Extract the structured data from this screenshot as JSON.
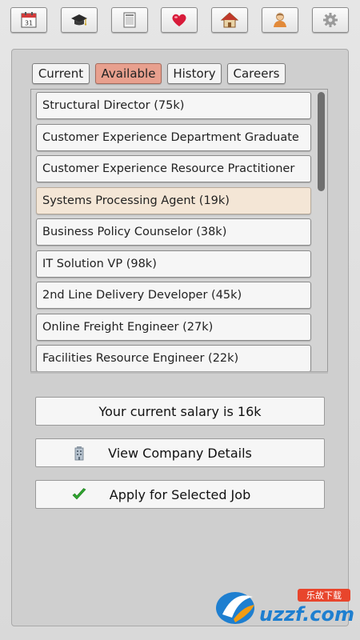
{
  "toolbar": {
    "buttons": [
      {
        "name": "calendar-icon"
      },
      {
        "name": "graduation-cap-icon"
      },
      {
        "name": "newspaper-icon"
      },
      {
        "name": "heart-icon"
      },
      {
        "name": "house-icon"
      },
      {
        "name": "person-icon"
      },
      {
        "name": "gear-icon"
      }
    ],
    "calendar_day": "31"
  },
  "tabs": [
    {
      "label": "Current",
      "active": false
    },
    {
      "label": "Available",
      "active": true
    },
    {
      "label": "History",
      "active": false
    },
    {
      "label": "Careers",
      "active": false
    }
  ],
  "jobs": [
    {
      "label": "Structural Director (75k)",
      "selected": false
    },
    {
      "label": "Customer Experience Department Graduate",
      "selected": false
    },
    {
      "label": "Customer Experience Resource Practitioner",
      "selected": false
    },
    {
      "label": "Systems Processing Agent (19k)",
      "selected": true
    },
    {
      "label": "Business Policy Counselor (38k)",
      "selected": false
    },
    {
      "label": "IT Solution VP (98k)",
      "selected": false
    },
    {
      "label": "2nd Line Delivery Developer (45k)",
      "selected": false
    },
    {
      "label": "Online Freight Engineer (27k)",
      "selected": false
    },
    {
      "label": "Facilities Resource Engineer (22k)",
      "selected": false
    }
  ],
  "salary_text": "Your current salary is 16k",
  "view_company_label": "View Company Details",
  "apply_label": "Apply for Selected Job",
  "watermark": {
    "tag": "乐故下载",
    "text": "uzzf.com"
  },
  "colors": {
    "active_tab": "#e8a08e",
    "selected_row": "#f4e6d6",
    "check_green": "#2fa52f"
  }
}
